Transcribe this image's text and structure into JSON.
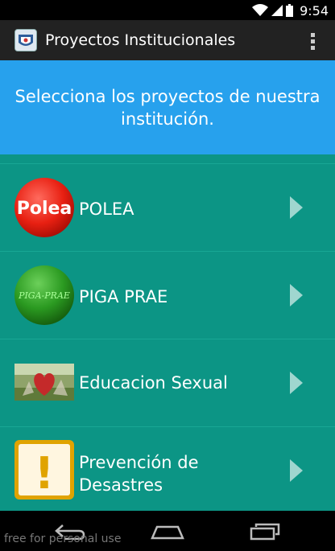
{
  "status_bar": {
    "time": "9:54"
  },
  "action_bar": {
    "title": "Proyectos Institucionales",
    "icon": "school-logo-icon",
    "menu_icon": "overflow-menu-icon"
  },
  "header": {
    "text": "Selecciona los proyectos de nuestra institución."
  },
  "list": {
    "items": [
      {
        "label": "POLEA",
        "thumb_text": "Polea",
        "icon": "polea-logo-icon"
      },
      {
        "label": "PIGA PRAE",
        "thumb_text": "PIGA-PRAE",
        "icon": "piga-prae-logo-icon"
      },
      {
        "label": "Educacion Sexual",
        "icon": "heart-photo-icon"
      },
      {
        "label_line1": "Prevención de",
        "label_line2": "Desastres",
        "thumb_text": "!",
        "icon": "warning-icon"
      }
    ]
  },
  "nav_bar": {
    "back_icon": "back-icon",
    "home_icon": "home-icon",
    "recents_icon": "recents-icon"
  },
  "watermark": "free for personal use",
  "colors": {
    "banner": "#27a1ed",
    "list_bg": "#0c9585",
    "action_bar": "#222222"
  }
}
